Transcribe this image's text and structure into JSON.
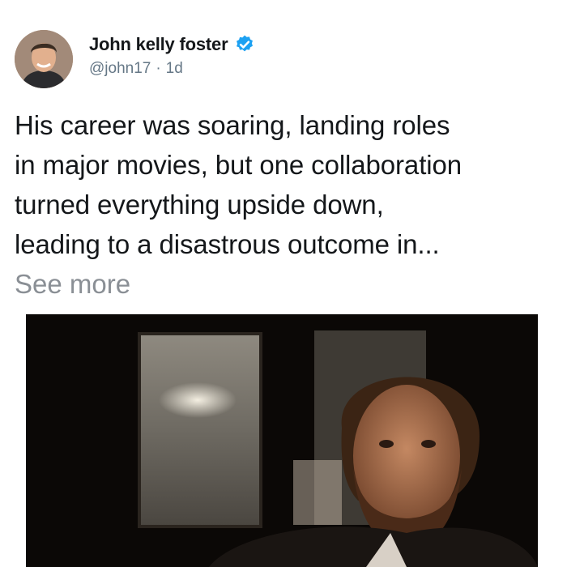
{
  "tweet": {
    "author": {
      "display_name": "John kelly foster",
      "handle": "@john17",
      "verified": true
    },
    "timestamp": "1d",
    "separator": "·",
    "text_lines": [
      "His career was soaring, landing roles",
      "in major movies, but one collaboration",
      "turned everything upside down,",
      "leading to a disastrous outcome in..."
    ],
    "see_more_label": "See more"
  },
  "icons": {
    "verified": "verified-badge-icon"
  },
  "colors": {
    "text": "#14171a",
    "secondary": "#657786",
    "see_more": "#8a8f95",
    "verified_blue": "#1da1f2"
  }
}
